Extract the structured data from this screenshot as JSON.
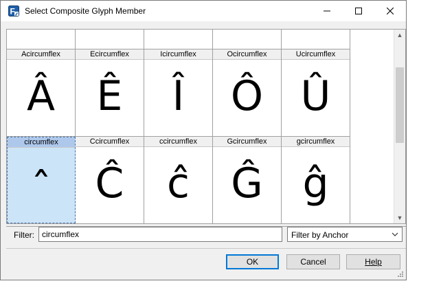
{
  "window": {
    "title": "Select Composite Glyph Member",
    "app_icon": "fontcreator-icon"
  },
  "title_controls": {
    "minimize": "minimize-icon",
    "maximize": "maximize-icon",
    "close": "close-icon"
  },
  "grid": {
    "row1": [
      {
        "name": "Acircumflex",
        "glyph": "Â"
      },
      {
        "name": "Ecircumflex",
        "glyph": "Ê"
      },
      {
        "name": "Icircumflex",
        "glyph": "Î"
      },
      {
        "name": "Ocircumflex",
        "glyph": "Ô"
      },
      {
        "name": "Ucircumflex",
        "glyph": "Û"
      }
    ],
    "row2": [
      {
        "name": "circumflex",
        "glyph": "ˆ",
        "selected": true
      },
      {
        "name": "Ccircumflex",
        "glyph": "Ĉ"
      },
      {
        "name": "ccircumflex",
        "glyph": "ĉ"
      },
      {
        "name": "Gcircumflex",
        "glyph": "Ĝ"
      },
      {
        "name": "gcircumflex",
        "glyph": "ĝ"
      }
    ]
  },
  "filter": {
    "label": "Filter:",
    "value": "circumflex"
  },
  "filter_mode": {
    "selected": "Filter by Anchor"
  },
  "buttons": {
    "ok": "OK",
    "cancel": "Cancel",
    "help": "Help"
  },
  "colors": {
    "selection": "#cce4f7",
    "default_button_border": "#0078d7"
  }
}
